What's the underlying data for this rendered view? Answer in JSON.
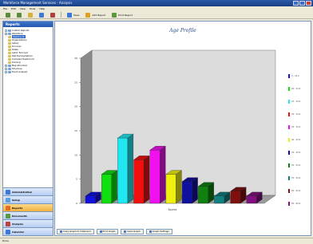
{
  "window": {
    "title": "Workforce Management Services - Analysis",
    "status_left": "Done",
    "status_right": ""
  },
  "menu": [
    "File",
    "Edit",
    "View",
    "Tools",
    "Help"
  ],
  "toolbar": {
    "buttons": [
      {
        "label": "Save",
        "icon": "save-icon",
        "color": "#3c78d8"
      },
      {
        "label": "Add Report",
        "icon": "add-report-icon",
        "color": "#e0a020"
      },
      {
        "label": "Print Report",
        "icon": "print-icon",
        "color": "#5a9a3c"
      }
    ]
  },
  "sidebar": {
    "header": "Reports",
    "tree": [
      {
        "label": "Custom Reports",
        "level": 1,
        "color": "#7aa0d8",
        "selected": false
      },
      {
        "label": "Workforce",
        "level": 1,
        "color": "#7aa0d8",
        "selected": false
      },
      {
        "label": "Headcount",
        "level": 2,
        "color": "#d8c060",
        "selected": true
      },
      {
        "label": "Organizations",
        "level": 2,
        "color": "#d8c060",
        "selected": false
      },
      {
        "label": "Salary",
        "level": 2,
        "color": "#d8c060",
        "selected": false
      },
      {
        "label": "Turnover",
        "level": 2,
        "color": "#d8c060",
        "selected": false
      },
      {
        "label": "Dates",
        "level": 2,
        "color": "#d8c060",
        "selected": false
      },
      {
        "label": "Labor Turnover",
        "level": 2,
        "color": "#d8c060",
        "selected": false
      },
      {
        "label": "Test Demographics",
        "level": 2,
        "color": "#d8c060",
        "selected": false
      },
      {
        "label": "Compare Headcount",
        "level": 2,
        "color": "#d8c060",
        "selected": false
      },
      {
        "label": "Training",
        "level": 2,
        "color": "#d8c060",
        "selected": false
      },
      {
        "label": "Map Structure",
        "level": 1,
        "color": "#7aa0d8",
        "selected": false
      },
      {
        "label": "Structure",
        "level": 1,
        "color": "#7aa0d8",
        "selected": false
      },
      {
        "label": "Trend Analysis",
        "level": 1,
        "color": "#7aa0d8",
        "selected": false
      }
    ],
    "nav": [
      {
        "label": "Administration",
        "color": "#3c78d8",
        "active": false
      },
      {
        "label": "Setup",
        "color": "#5aa0e0",
        "active": false
      },
      {
        "label": "Reports",
        "color": "#e07020",
        "active": true
      },
      {
        "label": "Documents",
        "color": "#5a9a3c",
        "active": false
      },
      {
        "label": "Analysis",
        "color": "#c04040",
        "active": false
      },
      {
        "label": "Calendar",
        "color": "#3c78d8",
        "active": false
      }
    ]
  },
  "bottom_buttons": [
    {
      "label": "Copy Graph to Clipboard"
    },
    {
      "label": "Print Graph"
    },
    {
      "label": "Save Graph"
    },
    {
      "label": "Graph Settings"
    }
  ],
  "chart_data": {
    "type": "bar",
    "title": "Age Profile",
    "xlabel": "Source",
    "ylabel": "",
    "ylim": [
      0,
      30
    ],
    "yticks": [
      0,
      5,
      10,
      15,
      20,
      25,
      30
    ],
    "three_d": true,
    "grid": false,
    "legend_position": "right",
    "categories": [
      "0 - 19.9",
      "20 - 24.9",
      "25 - 29.9",
      "30 - 34.9",
      "35 - 39.9",
      "40 - 44.9",
      "45 - 49.9",
      "50 - 54.9",
      "55 - 59.9",
      "60 - 64.9",
      "65 - 69.9"
    ],
    "values": [
      1.5,
      6,
      13.5,
      9,
      11,
      6,
      4.5,
      3.5,
      1.5,
      2.5,
      1.5
    ],
    "colors": [
      "#1010e0",
      "#10e010",
      "#20e8f0",
      "#f01010",
      "#f010f0",
      "#f0f010",
      "#1010a0",
      "#108010",
      "#108080",
      "#801010",
      "#801080"
    ]
  }
}
